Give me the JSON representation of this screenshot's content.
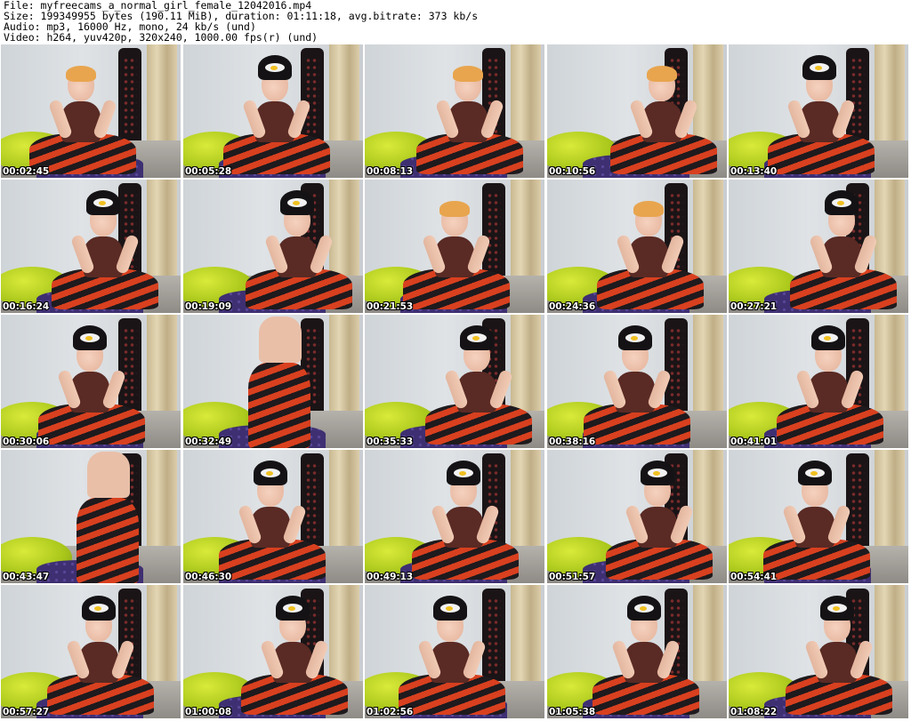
{
  "header": {
    "line1": "File: myfreecams_a_normal_girl_female_12042016.mp4",
    "line2": "Size: 199349955 bytes (190.11 MiB), duration: 01:11:18, avg.bitrate: 373 kb/s",
    "line3": "Audio: mp3, 16000 Hz, mono, 24 kb/s (und)",
    "line4": "Video: h264, yuv420p, 320x240, 1000.00 fps(r) (und)"
  },
  "thumbnails": [
    {
      "time": "00:02:45",
      "hat": false
    },
    {
      "time": "00:05:28",
      "hat": true
    },
    {
      "time": "00:08:13",
      "hat": false
    },
    {
      "time": "00:10:56",
      "hat": false
    },
    {
      "time": "00:13:40",
      "hat": true
    },
    {
      "time": "00:16:24",
      "hat": true
    },
    {
      "time": "00:19:09",
      "hat": true
    },
    {
      "time": "00:21:53",
      "hat": false
    },
    {
      "time": "00:24:36",
      "hat": false
    },
    {
      "time": "00:27:21",
      "hat": true
    },
    {
      "time": "00:30:06",
      "hat": true
    },
    {
      "time": "00:32:49",
      "hat": false,
      "standing": true
    },
    {
      "time": "00:35:33",
      "hat": true
    },
    {
      "time": "00:38:16",
      "hat": true
    },
    {
      "time": "00:41:01",
      "hat": true
    },
    {
      "time": "00:43:47",
      "hat": false,
      "standing": true
    },
    {
      "time": "00:46:30",
      "hat": true
    },
    {
      "time": "00:49:13",
      "hat": true
    },
    {
      "time": "00:51:57",
      "hat": true
    },
    {
      "time": "00:54:41",
      "hat": true
    },
    {
      "time": "00:57:27",
      "hat": true
    },
    {
      "time": "01:00:08",
      "hat": true
    },
    {
      "time": "01:02:56",
      "hat": true
    },
    {
      "time": "01:05:38",
      "hat": true
    },
    {
      "time": "01:08:22",
      "hat": true
    }
  ]
}
